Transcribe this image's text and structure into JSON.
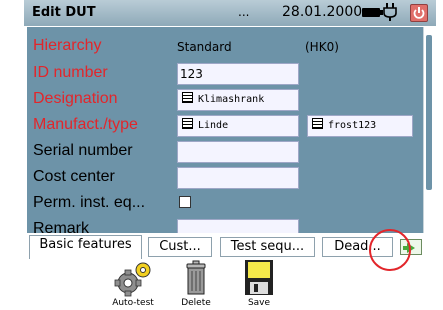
{
  "titlebar": {
    "title": "Edit DUT",
    "ellipsis": "...",
    "date": "28.01.2000"
  },
  "form": {
    "hierarchy": {
      "label": "Hierarchy",
      "value": "Standard",
      "code": "(HK0)"
    },
    "id_number": {
      "label": "ID number",
      "value": "123"
    },
    "designation": {
      "label": "Designation",
      "value": "Klimashrank"
    },
    "manufact_type": {
      "label": "Manufact./type",
      "manufacturer": "Linde",
      "type": "frost123"
    },
    "serial_number": {
      "label": "Serial number",
      "value": ""
    },
    "cost_center": {
      "label": "Cost center",
      "value": ""
    },
    "perm_inst": {
      "label": "Perm. inst. eq...",
      "checked": false
    },
    "remark": {
      "label": "Remark"
    }
  },
  "tabs": [
    "Basic features",
    "Cust...",
    "Test sequ...",
    "Dead..."
  ],
  "toolbar": {
    "autotest": "Auto-test",
    "delete": "Delete",
    "save": "Save"
  },
  "colors": {
    "panel": "#6d93a8",
    "required_label": "#e2262b",
    "next_arrow": "#49a83a"
  },
  "icons": [
    "battery-icon",
    "plug-icon",
    "power-icon",
    "next-arrow-icon"
  ]
}
